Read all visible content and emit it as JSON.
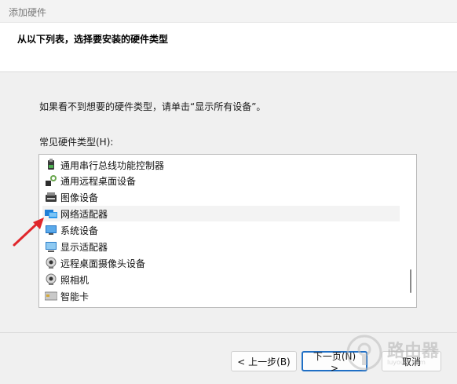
{
  "window": {
    "title": "添加硬件"
  },
  "header": {
    "heading": "从以下列表，选择要安装的硬件类型"
  },
  "instruction": "如果看不到想要的硬件类型，请单击“显示所有设备”。",
  "list_label": "常见硬件类型(H):",
  "hardware_list": [
    {
      "label": "通用串行总线功能控制器",
      "icon": "usb-icon"
    },
    {
      "label": "通用远程桌面设备",
      "icon": "remote-desktop-device-icon"
    },
    {
      "label": "图像设备",
      "icon": "imaging-device-icon"
    },
    {
      "label": "网络适配器",
      "icon": "network-adapter-icon"
    },
    {
      "label": "系统设备",
      "icon": "system-device-icon"
    },
    {
      "label": "显示适配器",
      "icon": "display-adapter-icon"
    },
    {
      "label": "远程桌面摄像头设备",
      "icon": "webcam-icon"
    },
    {
      "label": "照相机",
      "icon": "camera-icon"
    },
    {
      "label": "智能卡",
      "icon": "smart-card-icon"
    }
  ],
  "buttons": {
    "back": "< 上一步(B)",
    "next": "下一页(N) >",
    "cancel": "取消"
  },
  "watermark": {
    "text": "路由器",
    "sub": "luyouqi.com"
  },
  "colors": {
    "accent": "#1f6fc5",
    "annotation_arrow": "#e0262b"
  }
}
